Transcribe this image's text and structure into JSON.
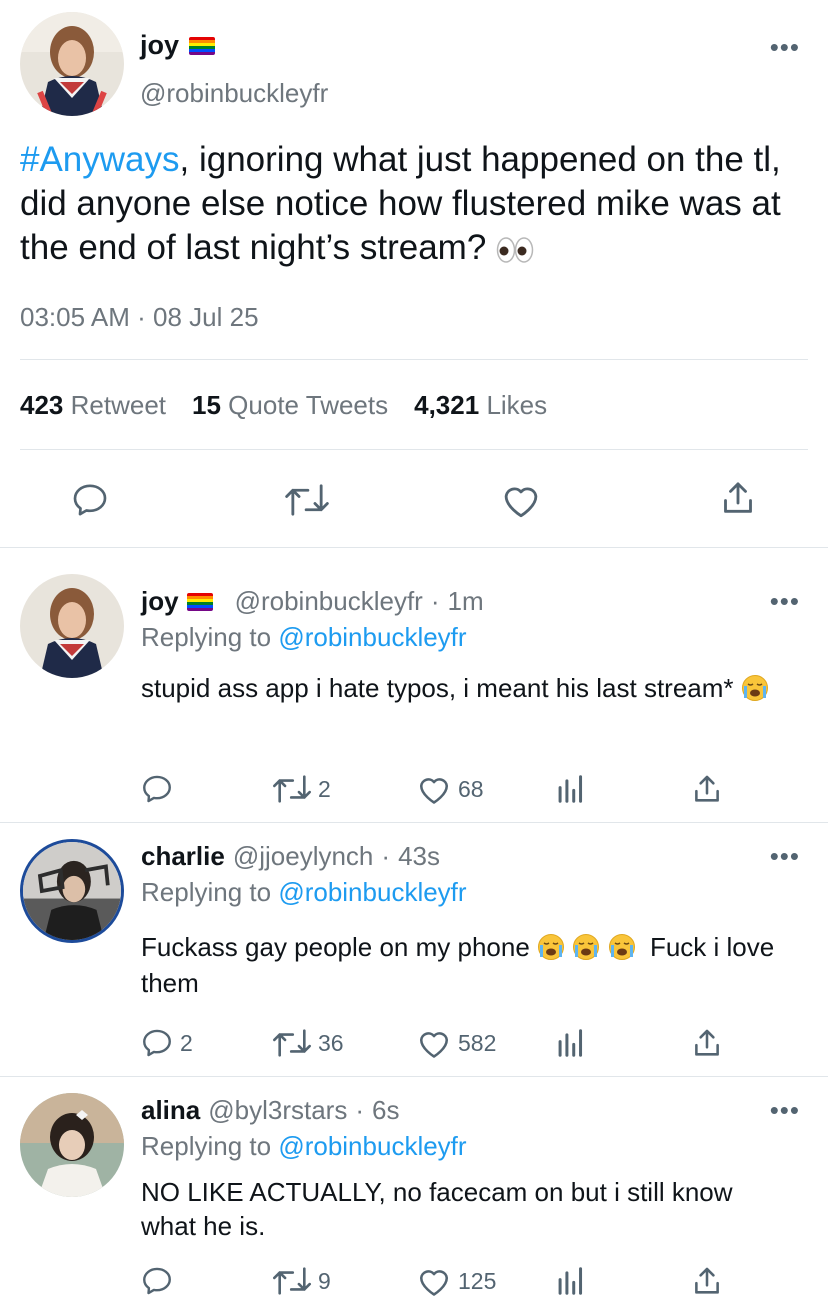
{
  "main_tweet": {
    "name": "joy",
    "handle": "@robinbuckleyfr",
    "hashtag": "#Anyways",
    "text": ", ignoring what just happened on the tl, did anyone else notice how flustered mike was at the end of last night’s stream?",
    "time": "03:05 AM",
    "date": "08 Jul 25",
    "sep": "·",
    "retweets": "423",
    "retweets_label": "Retweet",
    "quotes": "15",
    "quotes_label": "Quote Tweets",
    "likes": "4,321",
    "likes_label": "Likes",
    "more": "•••"
  },
  "replies": [
    {
      "name": "joy",
      "handle": "@robinbuckleyfr",
      "time": "1m",
      "replying_prefix": "Replying to",
      "replying_to": "@robinbuckleyfr",
      "text": "stupid ass app i hate typos, i meant his last stream*",
      "replies_count": "",
      "retweets": "2",
      "likes": "68"
    },
    {
      "name": "charlie",
      "handle": "@jjoeylynch",
      "time": "43s",
      "replying_prefix": "Replying to",
      "replying_to": "@robinbuckleyfr",
      "text_a": "Fuckass gay people on my phone",
      "text_b": "Fuck i love them",
      "replies_count": "2",
      "retweets": "36",
      "likes": "582"
    },
    {
      "name": "alina",
      "handle": "@byl3rstars",
      "time": "6s",
      "replying_prefix": "Replying to",
      "replying_to": "@robinbuckleyfr",
      "text": "NO LIKE ACTUALLY, no facecam on but i still know what he is.",
      "replies_count": "",
      "retweets": "9",
      "likes": "125"
    }
  ],
  "icons": [
    "reply-icon",
    "retweet-icon",
    "like-icon",
    "analytics-icon",
    "share-icon",
    "more-icon",
    "pride-flag-icon",
    "eyes-emoji-icon",
    "crying-emoji-icon"
  ],
  "colors": {
    "link": "#1d9bf0",
    "muted": "#6e767d",
    "text": "#0f1419",
    "divider": "#e1e6ea"
  }
}
